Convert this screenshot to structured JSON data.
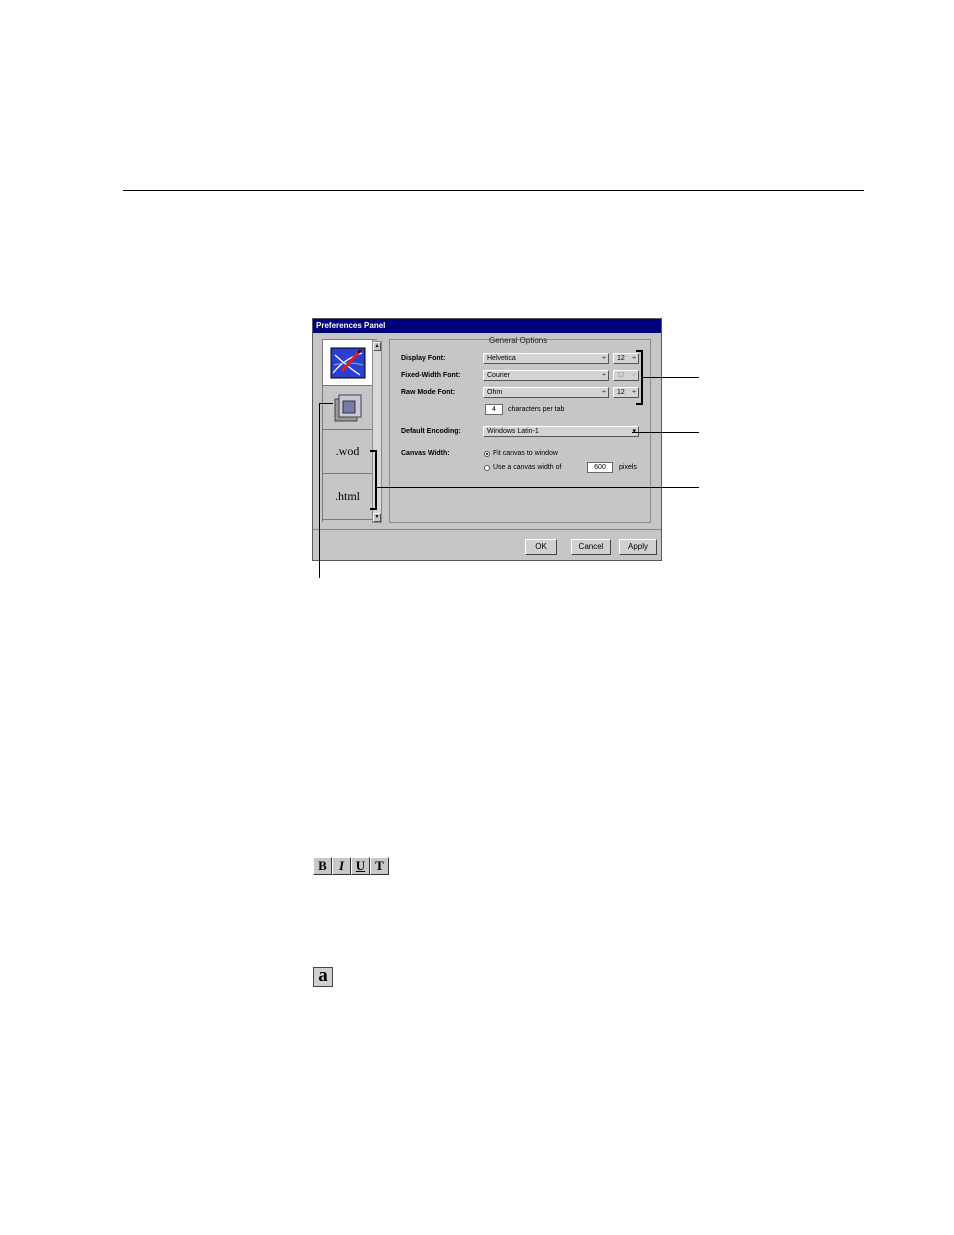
{
  "window": {
    "title": "Preferences Panel"
  },
  "sidebar": {
    "items": [
      {
        "icon": "general-options-icon"
      },
      {
        "icon": "layers-icon"
      },
      {
        "label": ".wod"
      },
      {
        "label": ".html"
      }
    ],
    "scroll_up": "▲",
    "scroll_down": "▼"
  },
  "general": {
    "title": "General Options",
    "display_font": {
      "label": "Display Font:",
      "value": "Helvetica",
      "size": "12"
    },
    "fixed_width_font": {
      "label": "Fixed-Width Font:",
      "value": "Courier",
      "size": "12"
    },
    "raw_mode_font": {
      "label": "Raw Mode Font:",
      "value": "Ohm",
      "size": "12"
    },
    "tab": {
      "value": "4",
      "suffix": "characters per tab"
    },
    "default_encoding": {
      "label": "Default Encoding:",
      "value": "Windows Latin-1"
    },
    "canvas_width": {
      "label": "Canvas Width:",
      "option_fit": "Fit canvas to window",
      "option_custom": "Use a canvas width of",
      "custom_value": "600",
      "custom_suffix": "pixels"
    }
  },
  "buttons": {
    "ok": "OK",
    "cancel": "Cancel",
    "apply": "Apply"
  },
  "toolbar": {
    "bold": "B",
    "italic": "I",
    "underline": "U",
    "teletype": "T"
  },
  "misc": {
    "glyph_a": "a"
  },
  "arrow_glyph": "÷",
  "colors": {
    "titlebar": "#00007b",
    "panel": "#c6c6c6"
  }
}
